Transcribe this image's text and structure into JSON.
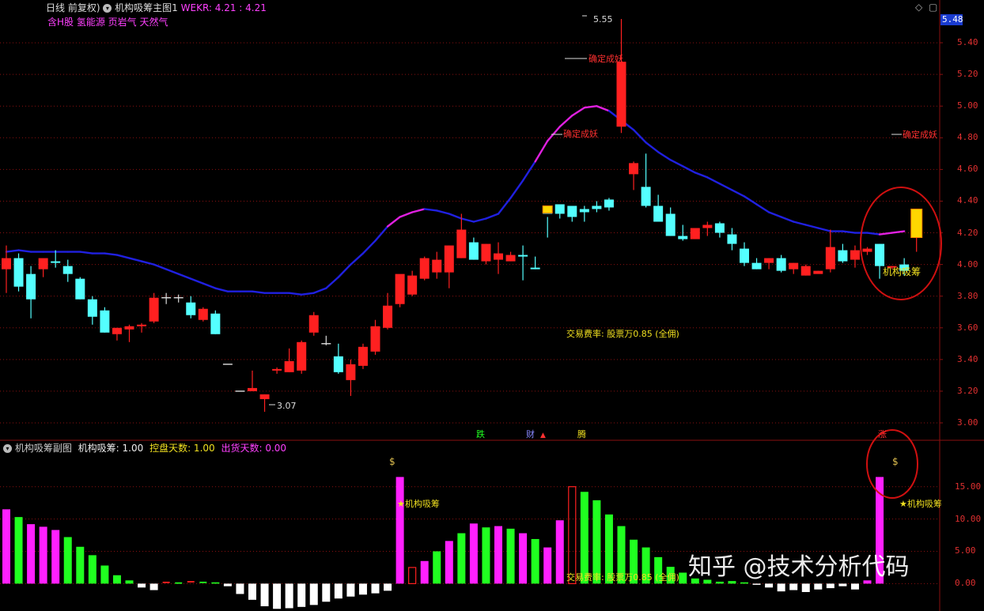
{
  "main_header": {
    "period": "日线 前复权)",
    "indicator_name": "机构吸筹主图1",
    "wekr_label": "WEKR: 4.21 : 4.21",
    "tags": "含H股 氢能源 页岩气 天然气",
    "corner_icons": [
      "diamond-icon",
      "square-icon"
    ]
  },
  "price_axis": {
    "current_price": "5.48",
    "ticks": [
      "5.40",
      "5.20",
      "5.00",
      "4.80",
      "4.60",
      "4.40",
      "4.20",
      "4.00",
      "3.80",
      "3.60",
      "3.40",
      "3.20",
      "3.00"
    ]
  },
  "annotations": {
    "high_label": "5.55",
    "low_label": "3.07",
    "confirm_1": "确定成妖",
    "confirm_2": "确定成妖",
    "confirm_3": "确定成妖",
    "inst_main": "机构吸筹",
    "fee_main": "交易费率: 股票万0.85 (全佣)",
    "event_die": "跌",
    "event_cai": "财",
    "event_teng": "腾",
    "event_zhang": "涨"
  },
  "sub_header": {
    "name": "机构吸筹副图",
    "inst_label": "机构吸筹: 1.00",
    "ctrl_label": "控盘天数: 1.00",
    "ship_label": "出货天数: 0.00"
  },
  "sub_axis": {
    "ticks": [
      "15.00",
      "10.00",
      "5.00",
      "0.00"
    ]
  },
  "sub_annotations": {
    "inst_1": "机构吸筹",
    "inst_2": "机构吸筹",
    "fee_sub": "交易费率: 股票万0.85 (全佣)"
  },
  "watermark": "知乎 @技术分析代码",
  "colors": {
    "up": "#ff2020",
    "down": "#54ffff",
    "ma": "#2020e0",
    "ma_hot": "#e020e0",
    "bar_magenta": "#ff20ff",
    "bar_green": "#20ff20",
    "bar_white": "#ffffff",
    "grid": "#8a1010",
    "highlight": "#ffd700",
    "circle": "#d01010"
  },
  "chart_data": {
    "type": "candlestick",
    "ylim": [
      2.95,
      5.58
    ],
    "candles": [
      [
        3.97,
        4.12,
        3.82,
        4.04
      ],
      [
        4.04,
        4.07,
        3.83,
        3.86
      ],
      [
        3.94,
        3.99,
        3.66,
        3.78
      ],
      [
        3.97,
        4.01,
        3.92,
        4.04
      ],
      [
        4.02,
        4.09,
        3.98,
        4.01
      ],
      [
        3.99,
        4.03,
        3.89,
        3.94
      ],
      [
        3.91,
        3.92,
        3.78,
        3.78
      ],
      [
        3.78,
        3.8,
        3.62,
        3.67
      ],
      [
        3.71,
        3.73,
        3.57,
        3.57
      ],
      [
        3.56,
        3.6,
        3.52,
        3.6
      ],
      [
        3.59,
        3.62,
        3.51,
        3.61
      ],
      [
        3.61,
        3.63,
        3.57,
        3.62
      ],
      [
        3.64,
        3.82,
        3.63,
        3.79
      ],
      [
        3.79,
        3.82,
        3.75,
        3.79
      ],
      [
        3.79,
        3.81,
        3.76,
        3.79
      ],
      [
        3.76,
        3.8,
        3.66,
        3.68
      ],
      [
        3.65,
        3.73,
        3.64,
        3.72
      ],
      [
        3.69,
        3.71,
        3.56,
        3.56
      ],
      [
        3.37,
        3.37,
        3.37,
        3.37
      ],
      [
        3.2,
        3.2,
        3.2,
        3.2
      ],
      [
        3.2,
        3.33,
        3.2,
        3.22
      ],
      [
        3.15,
        3.18,
        3.07,
        3.18
      ],
      [
        3.33,
        3.35,
        3.31,
        3.34
      ],
      [
        3.32,
        3.47,
        3.32,
        3.39
      ],
      [
        3.33,
        3.52,
        3.31,
        3.51
      ],
      [
        3.57,
        3.7,
        3.55,
        3.68
      ],
      [
        3.5,
        3.55,
        3.49,
        3.5
      ],
      [
        3.42,
        3.5,
        3.31,
        3.32
      ],
      [
        3.27,
        3.4,
        3.17,
        3.37
      ],
      [
        3.36,
        3.5,
        3.34,
        3.48
      ],
      [
        3.45,
        3.65,
        3.43,
        3.61
      ],
      [
        3.6,
        3.82,
        3.59,
        3.74
      ],
      [
        3.75,
        3.93,
        3.73,
        3.94
      ],
      [
        3.81,
        3.96,
        3.8,
        3.93
      ],
      [
        3.91,
        4.05,
        3.9,
        4.04
      ],
      [
        3.95,
        4.08,
        3.91,
        4.03
      ],
      [
        3.95,
        4.12,
        3.85,
        4.12
      ],
      [
        4.04,
        4.32,
        4.04,
        4.22
      ],
      [
        4.14,
        4.17,
        4.03,
        4.03
      ],
      [
        4.02,
        4.13,
        4.0,
        4.13
      ],
      [
        4.03,
        4.14,
        3.94,
        4.07
      ],
      [
        4.02,
        4.08,
        4.02,
        4.06
      ],
      [
        4.06,
        4.12,
        3.9,
        4.05
      ],
      [
        3.98,
        4.05,
        3.97,
        3.97
      ],
      [
        4.37,
        4.3,
        4.17,
        4.32
      ],
      [
        4.38,
        4.37,
        4.29,
        4.32
      ],
      [
        4.37,
        4.36,
        4.27,
        4.3
      ],
      [
        4.35,
        4.37,
        4.27,
        4.33
      ],
      [
        4.37,
        4.4,
        4.33,
        4.35
      ],
      [
        4.41,
        4.42,
        4.34,
        4.36
      ],
      [
        4.87,
        5.55,
        4.83,
        5.28
      ],
      [
        4.57,
        4.65,
        4.47,
        4.64
      ],
      [
        4.49,
        4.7,
        4.36,
        4.37
      ],
      [
        4.37,
        4.44,
        4.27,
        4.27
      ],
      [
        4.32,
        4.36,
        4.18,
        4.18
      ],
      [
        4.18,
        4.25,
        4.15,
        4.16
      ],
      [
        4.16,
        4.22,
        4.16,
        4.23
      ],
      [
        4.23,
        4.27,
        4.18,
        4.25
      ],
      [
        4.26,
        4.27,
        4.17,
        4.2
      ],
      [
        4.19,
        4.23,
        4.09,
        4.13
      ],
      [
        4.1,
        4.14,
        3.99,
        4.01
      ],
      [
        4.01,
        4.04,
        3.97,
        3.97
      ],
      [
        4.01,
        4.04,
        3.97,
        4.04
      ],
      [
        4.04,
        4.06,
        3.95,
        3.96
      ],
      [
        3.97,
        4.01,
        3.94,
        4.01
      ],
      [
        3.93,
        4.0,
        3.93,
        3.99
      ],
      [
        3.94,
        3.96,
        3.95,
        3.96
      ],
      [
        3.97,
        4.22,
        3.95,
        4.11
      ],
      [
        4.09,
        4.13,
        4.01,
        4.02
      ],
      [
        4.03,
        4.12,
        3.98,
        4.09
      ],
      [
        4.08,
        4.11,
        4.06,
        4.1
      ],
      [
        4.13,
        4.13,
        3.91,
        3.99
      ],
      [
        3.98,
        3.99,
        3.97,
        3.99
      ],
      [
        4.0,
        4.04,
        3.93,
        3.96
      ],
      [
        4.17,
        4.35,
        4.08,
        4.35
      ]
    ],
    "ma": [
      4.08,
      4.09,
      4.08,
      4.08,
      4.08,
      4.08,
      4.08,
      4.07,
      4.07,
      4.06,
      4.04,
      4.02,
      4.0,
      3.97,
      3.94,
      3.91,
      3.88,
      3.85,
      3.83,
      3.83,
      3.83,
      3.82,
      3.82,
      3.82,
      3.81,
      3.82,
      3.85,
      3.92,
      4.0,
      4.07,
      4.15,
      4.24,
      4.3,
      4.33,
      4.35,
      4.34,
      4.32,
      4.29,
      4.27,
      4.29,
      4.32,
      4.42,
      4.53,
      4.65,
      4.78,
      4.87,
      4.94,
      4.99,
      5.0,
      4.97,
      4.91,
      4.85,
      4.77,
      4.71,
      4.66,
      4.62,
      4.58,
      4.55,
      4.51,
      4.47,
      4.43,
      4.38,
      4.33,
      4.3,
      4.27,
      4.25,
      4.23,
      4.21,
      4.21,
      4.2,
      4.2,
      4.19,
      4.2,
      4.21
    ],
    "sub_ylim": [
      -3.5,
      19
    ],
    "sub_bars": [
      11.5,
      10.3,
      9.2,
      8.8,
      8.3,
      7.2,
      5.7,
      4.4,
      2.8,
      1.3,
      0.5,
      -0.6,
      -1.0,
      0.3,
      0.2,
      0.4,
      0.3,
      0.2,
      -0.4,
      -1.6,
      -2.5,
      -3.5,
      -3.9,
      -3.8,
      -3.6,
      -3.3,
      -2.8,
      -2.3,
      -2.0,
      -1.7,
      -1.5,
      -1.1,
      16.5,
      2.5,
      3.5,
      5.0,
      6.6,
      7.8,
      9.3,
      8.7,
      8.9,
      8.5,
      7.8,
      6.9,
      5.6,
      9.8,
      15.0,
      14.2,
      12.9,
      10.7,
      8.9,
      6.8,
      5.6,
      4.1,
      2.6,
      1.7,
      0.8,
      0.6,
      0.3,
      0.4,
      0.2,
      -0.1,
      -0.6,
      -1.2,
      -1.0,
      -1.3,
      -0.9,
      -0.7,
      -0.4,
      -0.9,
      0.5,
      16.5
    ]
  }
}
